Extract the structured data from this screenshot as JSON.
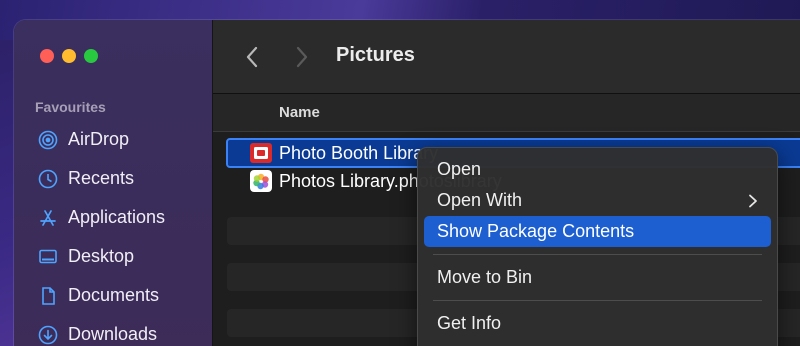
{
  "window": {
    "title": "Pictures"
  },
  "sidebar": {
    "section_title": "Favourites",
    "items": [
      {
        "label": "AirDrop",
        "icon": "airdrop-icon"
      },
      {
        "label": "Recents",
        "icon": "clock-icon"
      },
      {
        "label": "Applications",
        "icon": "applications-icon"
      },
      {
        "label": "Desktop",
        "icon": "desktop-icon"
      },
      {
        "label": "Documents",
        "icon": "document-icon"
      },
      {
        "label": "Downloads",
        "icon": "download-icon"
      }
    ]
  },
  "columns": {
    "name": "Name"
  },
  "files": [
    {
      "name": "Photo Booth Library",
      "icon": "photo-booth-icon",
      "selected": true
    },
    {
      "name": "Photos Library.photoslibrary",
      "icon": "photos-icon",
      "selected": false
    }
  ],
  "context_menu": {
    "items": [
      {
        "label": "Open"
      },
      {
        "label": "Open With",
        "submenu": true
      },
      {
        "label": "Show Package Contents",
        "highlighted": true
      },
      {
        "label": "Move to Bin"
      },
      {
        "label": "Get Info"
      }
    ]
  },
  "colors": {
    "accent": "#1d5fd1",
    "selection": "#0a3a93",
    "close": "#ff5f57",
    "minimize": "#febc2e",
    "zoom": "#28c840"
  }
}
